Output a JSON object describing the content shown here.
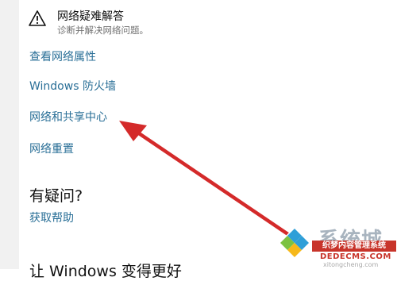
{
  "troubleshoot": {
    "title": "网络疑难解答",
    "description": "诊断并解决网络问题。",
    "icon": "warning-triangle-icon"
  },
  "links": {
    "properties": "查看网络属性",
    "firewall": "Windows 防火墙",
    "sharing_center": "网络和共享中心",
    "reset": "网络重置"
  },
  "help": {
    "heading": "有疑问?",
    "link": "获取帮助"
  },
  "cut_heading": "让 Windows 变得更好",
  "watermark": {
    "brand": "系统城",
    "badge": "织梦内容管理系统",
    "domain": "DEDECMS.COM",
    "sub": "xitongcheng.com"
  },
  "colors": {
    "link": "#2a6f97",
    "arrow": "#d42a2a"
  }
}
